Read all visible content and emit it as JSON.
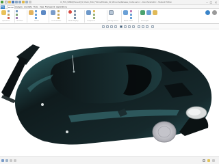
{
  "window": {
    "title": "Ul_FOS_W8RO[Prevent][1] Ulsini_Zilto_FlOrnia/Models_01 [Winsome/Release_model.asm.1 - Creo Parametric - Student Edition"
  },
  "menu": {
    "tabs": [
      "File",
      "Model",
      "Analysis",
      "Annotate",
      "Tools",
      "View",
      "Framework",
      "Applications"
    ]
  },
  "ribbon": {
    "operations_label": "Operations",
    "get_data_label": "Get Data",
    "datum_label": "Datum",
    "cut_surface_label": "Cut & Surface",
    "model_display_label": "Model Display",
    "component_label": "Component",
    "manage_views_label": "Manage Views",
    "model_intent_label": "Model Intent",
    "investigate_label": "Investigate"
  },
  "colors": {
    "car_body": "#0f1b1d",
    "car_highlight": "#2f6a6e",
    "wheel": "#cfcfd4",
    "accent_blue": "#3a84c9",
    "background": "#ffffff"
  }
}
